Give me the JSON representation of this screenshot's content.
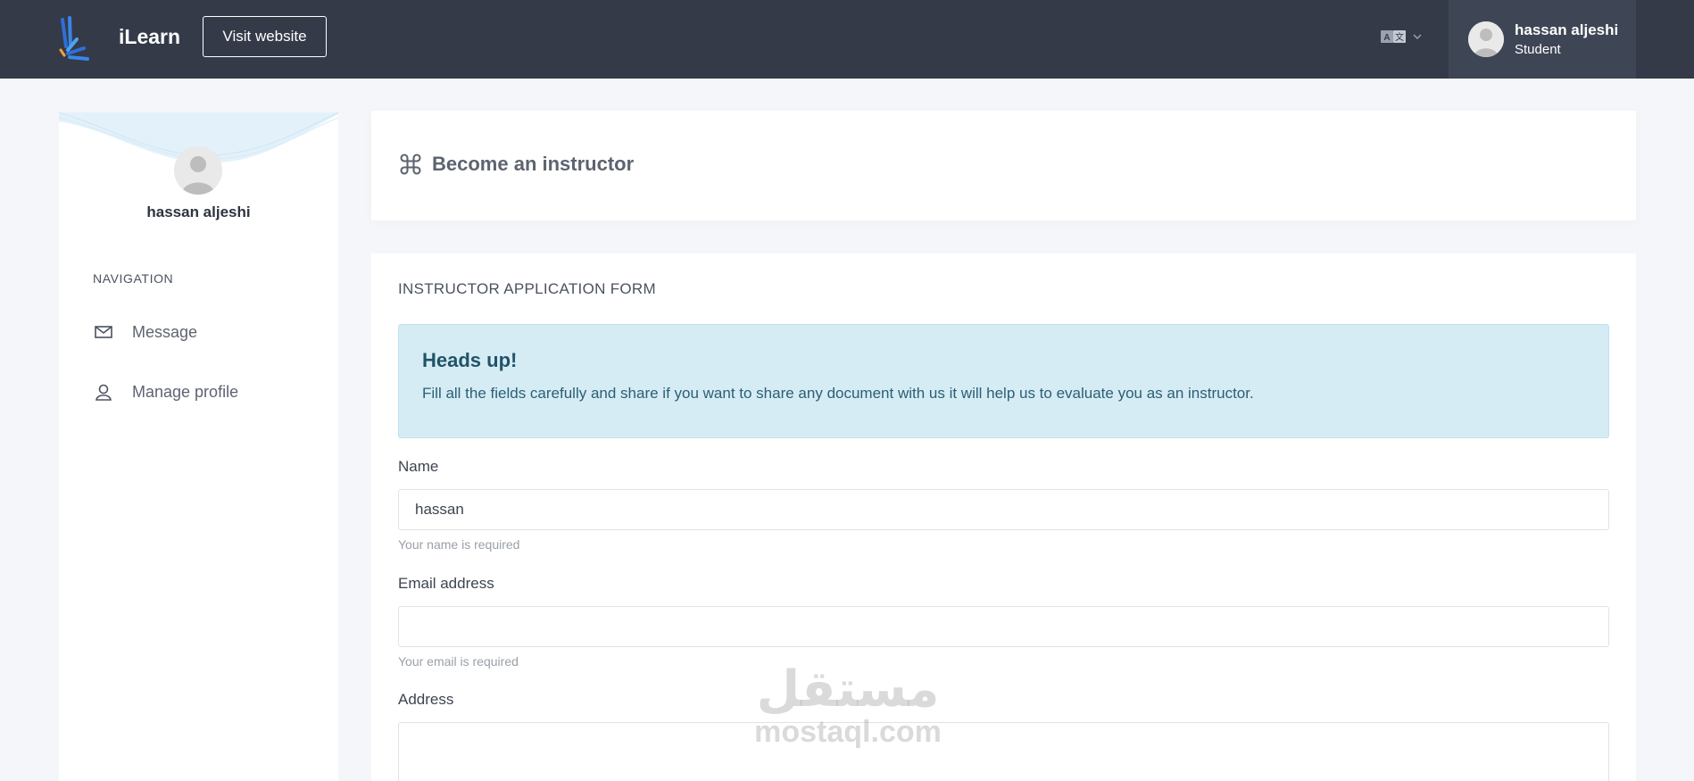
{
  "header": {
    "brand": "iLearn",
    "visit_button": "Visit website",
    "language_icon": "translate-icon",
    "user": {
      "name": "hassan aljeshi",
      "role": "Student"
    }
  },
  "sidebar": {
    "name": "hassan aljeshi",
    "nav_heading": "NAVIGATION",
    "items": [
      {
        "label": "Message",
        "icon": "envelope-icon"
      },
      {
        "label": "Manage profile",
        "icon": "user-icon"
      }
    ]
  },
  "main": {
    "page_title": "Become an instructor",
    "page_title_icon": "command-icon",
    "form_heading": "INSTRUCTOR APPLICATION FORM",
    "alert": {
      "title": "Heads up!",
      "text": "Fill all the fields carefully and share if you want to share any document with us it will help us to evaluate you as an instructor."
    },
    "fields": {
      "name": {
        "label": "Name",
        "value": "hassan",
        "help": "Your name is required"
      },
      "email": {
        "label": "Email address",
        "value": "",
        "help": "Your email is required"
      },
      "address": {
        "label": "Address",
        "value": ""
      }
    }
  },
  "watermark": {
    "arabic": "مستقل",
    "latin": "mostaql.com"
  },
  "colors": {
    "header_bg": "#343a48",
    "alert_bg": "#d6ecf4",
    "page_bg": "#f4f6f9"
  }
}
